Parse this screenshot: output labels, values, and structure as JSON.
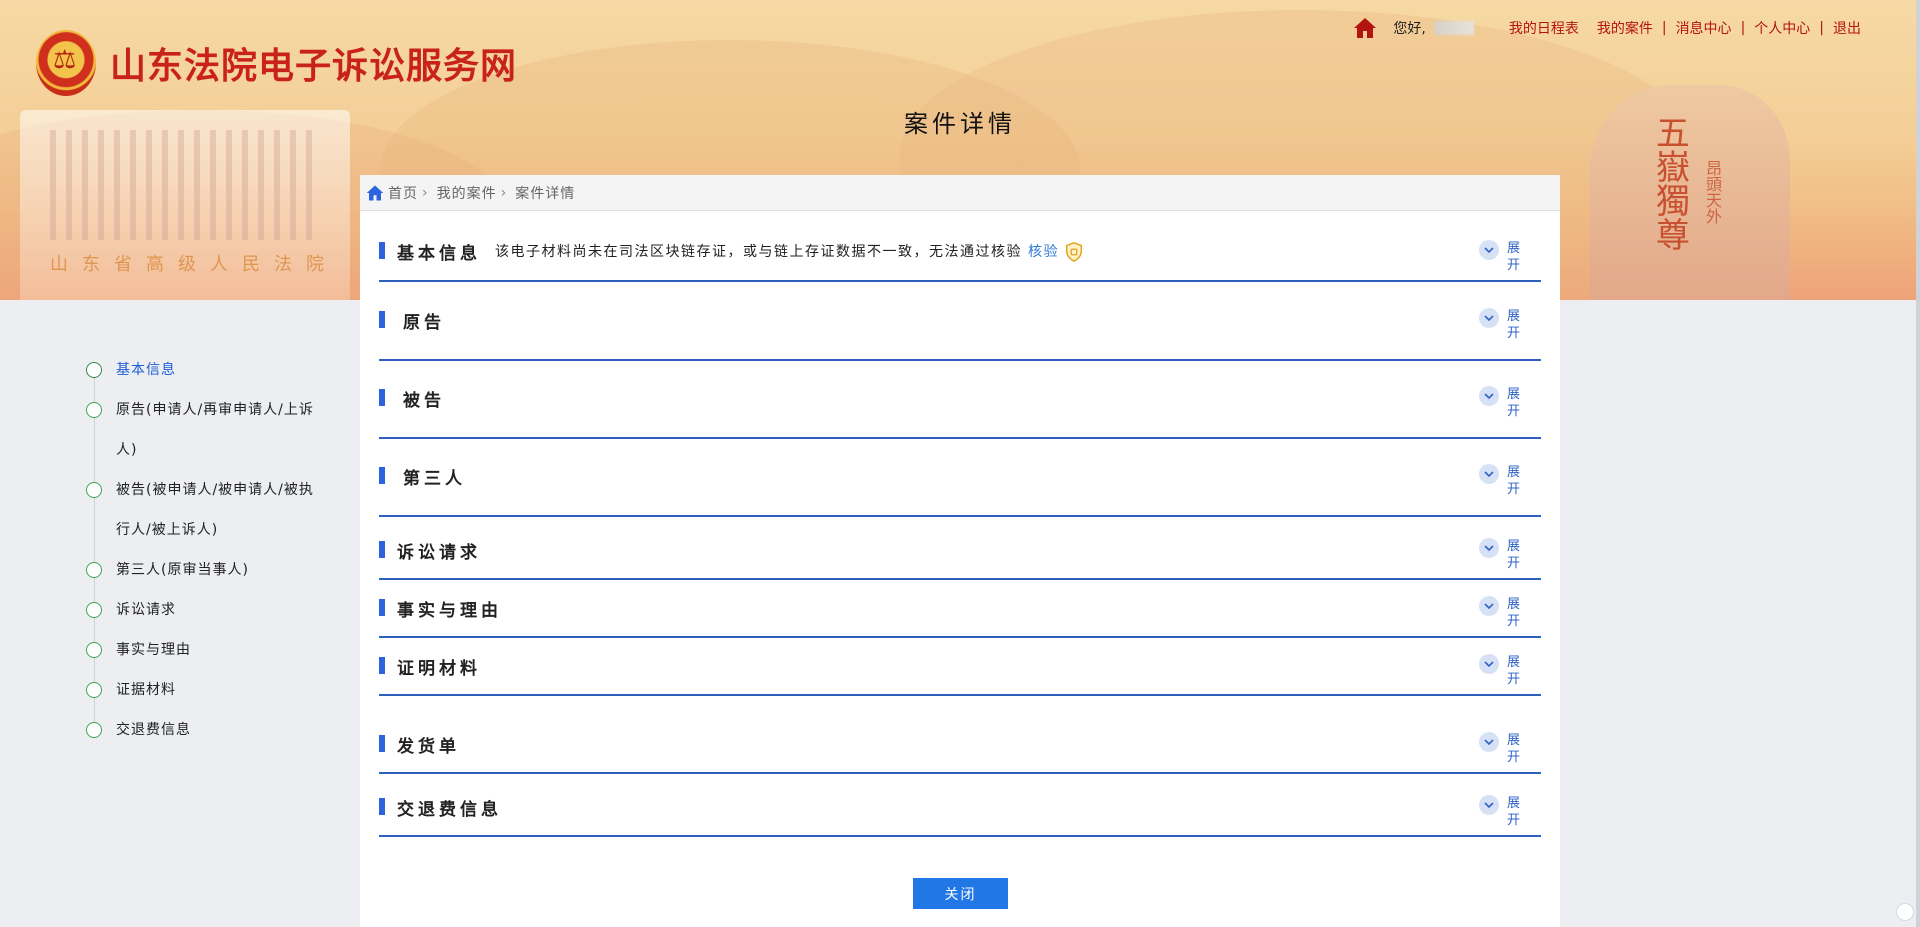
{
  "header": {
    "site_title": "山东法院电子诉讼服务网",
    "greeting": "您好,",
    "nav": [
      "我的日程表",
      "我的案件",
      "消息中心",
      "个人中心",
      "退出"
    ],
    "page_title": "案件详情"
  },
  "banner": {
    "rock_text": "五嶽獨尊",
    "rock_sub": "昂頭天外",
    "building_sign": "山东省高级人民法院"
  },
  "breadcrumb": [
    "首页",
    "我的案件",
    "案件详情"
  ],
  "left_nav": [
    {
      "label": "基本信息",
      "active": true
    },
    {
      "label": "原告(申请人/再审申请人/上诉人)",
      "line1": "原告(申请人/再审申请人/上诉",
      "line2": "人)"
    },
    {
      "label": "被告(被申请人/被申请人/被执行人/被上诉人)",
      "line1": "被告(被申请人/被申请人/被执",
      "line2": "行人/被上诉人)"
    },
    {
      "label": "第三人(原审当事人)"
    },
    {
      "label": "诉讼请求"
    },
    {
      "label": "事实与理由"
    },
    {
      "label": "证据材料"
    },
    {
      "label": "交退费信息"
    }
  ],
  "sections": [
    {
      "title": "基本信息",
      "notice": "该电子材料尚未在司法区块链存证，或与链上存证数据不一致，无法通过核验",
      "verify": "核验"
    },
    {
      "title": "原告"
    },
    {
      "title": "被告"
    },
    {
      "title": "第三人"
    },
    {
      "title": "诉讼请求"
    },
    {
      "title": "事实与理由"
    },
    {
      "title": "证明材料"
    },
    {
      "title": "发货单"
    },
    {
      "title": "交退费信息"
    }
  ],
  "expand_label": "展开",
  "close_label": "关闭",
  "colors": {
    "accent": "#2b63e0",
    "brand_red": "#c8221a",
    "link_red": "#b3140f",
    "button": "#2177e6",
    "nav_dot": "#39a84f"
  }
}
